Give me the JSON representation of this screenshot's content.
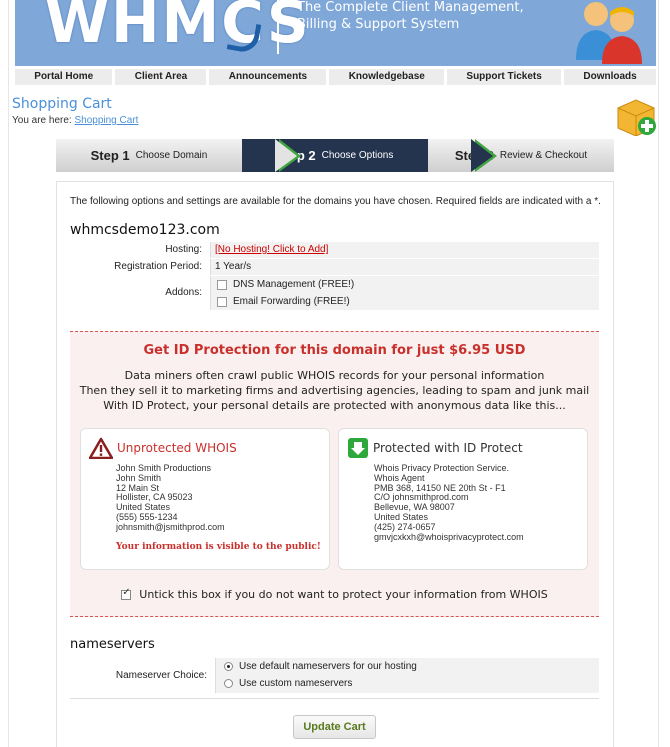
{
  "header": {
    "logo_text": "WHMCS",
    "tagline_line1": "The Complete Client Management,",
    "tagline_line2": "Billing & Support System"
  },
  "nav": {
    "items": [
      {
        "label": "Portal Home"
      },
      {
        "label": "Client Area"
      },
      {
        "label": "Announcements"
      },
      {
        "label": "Knowledgebase"
      },
      {
        "label": "Support Tickets"
      },
      {
        "label": "Downloads"
      }
    ]
  },
  "page": {
    "title": "Shopping Cart",
    "breadcrumb_prefix": "You are here:",
    "breadcrumb_link": "Shopping Cart"
  },
  "steps": [
    {
      "num": "Step 1",
      "label": "Choose Domain"
    },
    {
      "num": "Step 2",
      "label": "Choose Options"
    },
    {
      "num": "Step 3",
      "label": "Review & Checkout"
    }
  ],
  "form": {
    "intro": "The following options and settings are available for the domains you have chosen. Required fields are indicated with a *.",
    "domain": "whmcsdemo123.com",
    "hosting_label": "Hosting:",
    "hosting_value": "[No Hosting! Click to Add]",
    "period_label": "Registration Period:",
    "period_value": "1 Year/s",
    "addons_label": "Addons:",
    "addons": [
      {
        "label": "DNS Management (FREE!)"
      },
      {
        "label": "Email Forwarding (FREE!)"
      }
    ]
  },
  "promo": {
    "title": "Get ID Protection for this domain for just $6.95 USD",
    "line1": "Data miners often crawl public WHOIS records for your personal information",
    "line2": "Then they sell it to marketing firms and advertising agencies, leading to spam and junk mail",
    "line3": "With ID Protect, your personal details are protected with anonymous data like this...",
    "unprotected_title": "Unprotected WHOIS",
    "unprotected_lines": [
      "John Smith Productions",
      "John Smith",
      "12 Main St",
      "Hollister, CA 95023",
      "United States",
      "(555) 555-1234",
      "johnsmith@jsmithprod.com"
    ],
    "unprotected_warning": "Your information is visible to the public!",
    "protected_title": "Protected with ID Protect",
    "protected_lines": [
      "Whois Privacy Protection Service.",
      "Whois Agent",
      "PMB 368, 14150 NE 20th St - F1",
      "C/O johnsmithprod.com",
      "Bellevue, WA 98007",
      "United States",
      "(425) 274-0657",
      "gmvjcxkxh@whoisprivacyprotect.com"
    ],
    "untick_text": "Untick this box if you do not want to protect your information from WHOIS",
    "untick_checked": true
  },
  "nameservers": {
    "title": "nameservers",
    "choice_label": "Nameserver Choice:",
    "options": [
      {
        "label": "Use default nameservers for our hosting",
        "selected": true
      },
      {
        "label": "Use custom nameservers",
        "selected": false
      }
    ]
  },
  "actions": {
    "update_cart": "Update Cart"
  },
  "colors": {
    "banner": "#7fa7d8",
    "accent_blue": "#4a90d9",
    "step_active": "#24344f",
    "step_arrow": "#3fa63f",
    "promo_red": "#c9302c",
    "promo_bg": "#faf0ef"
  }
}
